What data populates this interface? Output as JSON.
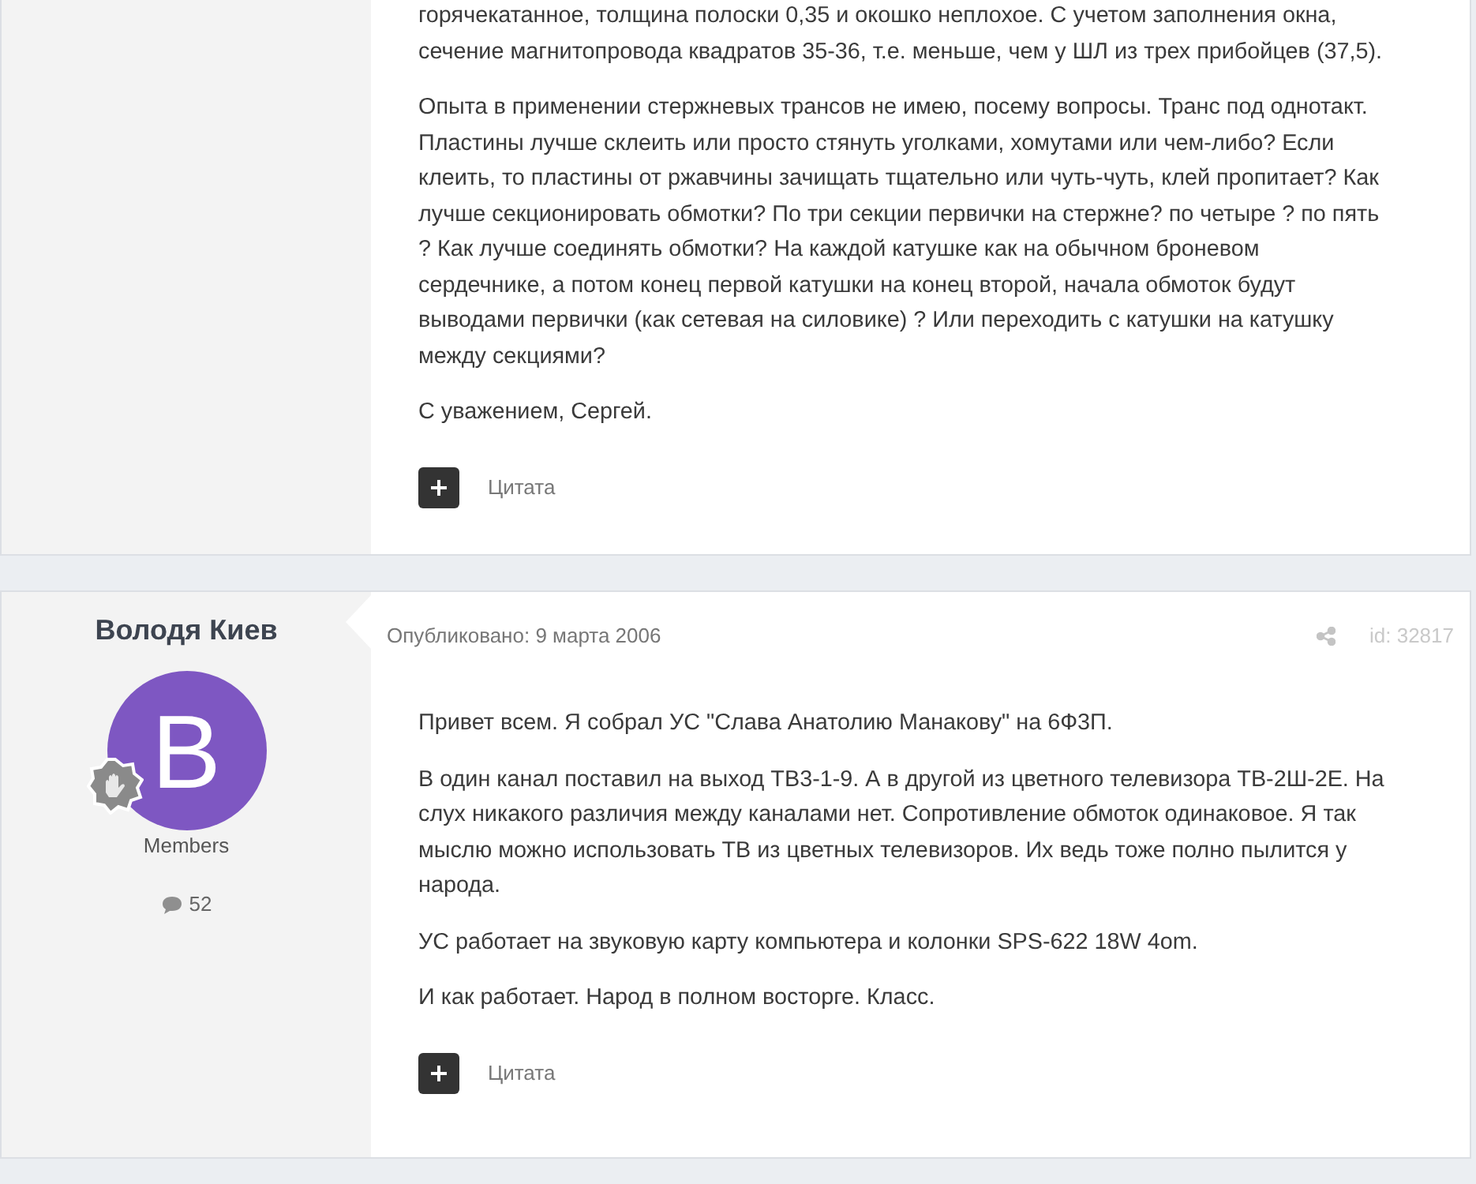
{
  "posts": [
    {
      "paragraphs": [
        "горячекатанное, толщина полоски 0,35 и окошко неплохое. С учетом заполнения окна, сечение магнитопровода квадратов 35-36, т.е. меньше, чем у ШЛ из трех прибойцев (37,5).",
        "Опыта в применении стержневых трансов не имею, посему вопросы. Транс под однотакт. Пластины лучше склеить или просто стянуть уголками, хомутами или чем-либо? Если клеить, то пластины от ржавчины зачищать тщательно или чуть-чуть, клей пропитает? Как лучше секционировать обмотки? По три секции первички на стержне? по четыре ? по пять ? Как лучше соединять обмотки? На каждой катушке как на обычном броневом сердечнике, а потом конец первой катушки на конец второй, начала обмоток будут выводами первички (как сетевая на силовике) ? Или переходить с катушки на катушку между секциями?",
        "С уважением, Сергей."
      ],
      "quote_label": "Цитата"
    },
    {
      "author": {
        "name": "Володя Киев",
        "avatar_letter": "B",
        "color": "#7e57c2",
        "group": "Members",
        "post_count": "52"
      },
      "published": "Опубликовано: 9 марта 2006",
      "post_id": "id: 32817",
      "paragraphs": [
        "Привет всем. Я собрал УС \"Слава Анатолию Манакову\" на 6Ф3П.",
        "В один канал поставил на выход ТВ3-1-9. А в другой из цветного телевизора ТВ-2Ш-2Е. На слух никакого различия между каналами нет. Сопротивление обмоток одинаковое. Я так мыслю можно использовать ТВ из цветных телевизоров. Их ведь тоже полно пылится у народа.",
        "УС работает на звуковую карту компьютера и колонки SPS-622 18W 4om.",
        "И как работает. Народ в полном восторге. Класс."
      ],
      "quote_label": "Цитата"
    }
  ]
}
